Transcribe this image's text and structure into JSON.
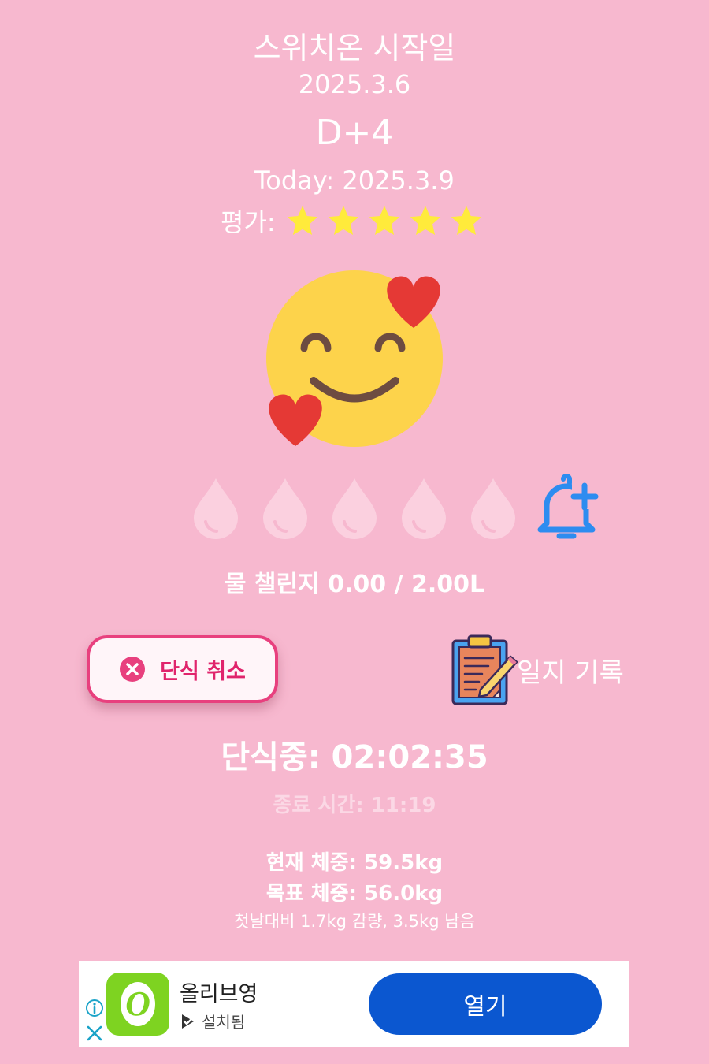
{
  "header": {
    "title": "스위치온 시작일",
    "start_date": "2025.3.6",
    "d_day": "D+4",
    "today": "Today: 2025.3.9"
  },
  "rating": {
    "label": "평가:",
    "value": 5,
    "max": 5,
    "star_color": "#ffeb3b"
  },
  "mood_icon": "smiling-face-with-hearts-icon",
  "water": {
    "cups_filled": 0,
    "cups_total": 5,
    "challenge_text": "물 챌린지 0.00 / 2.00L",
    "add_alarm_icon": "bell-plus-icon"
  },
  "actions": {
    "cancel_fast_label": "단식 취소",
    "journal_label": "일지 기록"
  },
  "fasting": {
    "status": "단식중: 02:02:35",
    "end_time": "종료 시간: 11:19"
  },
  "weight": {
    "current": "현재 체중: 59.5kg",
    "goal": "목표 체중: 56.0kg",
    "compare": "첫날대비 1.7kg 감량, 3.5kg 남음"
  },
  "ad": {
    "app_name": "올리브영",
    "status": "설치됨",
    "open_label": "열기",
    "app_icon_letter": "O",
    "button_color": "#0b57d0"
  },
  "colors": {
    "background": "#f7b8cf",
    "accent": "#e8407e",
    "bell": "#2d8cf0"
  }
}
